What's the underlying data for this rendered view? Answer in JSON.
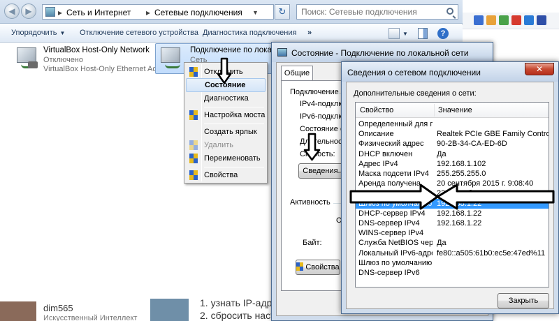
{
  "explorer": {
    "breadcrumb": [
      "Сеть и Интернет",
      "Сетевые подключения"
    ],
    "search_placeholder": "Поиск: Сетевые подключения",
    "toolbar": {
      "organize": "Упорядочить",
      "disable": "Отключение сетевого устройства",
      "diagnose": "Диагностика подключения"
    },
    "items": [
      {
        "name": "VirtualBox Host-Only Network",
        "status": "Отключено",
        "device": "VirtualBox Host-Only Ethernet Ad..."
      },
      {
        "name": "Подключение по локальн",
        "status": "Сеть"
      }
    ]
  },
  "context_menu": {
    "items": [
      {
        "label": "Отключить",
        "shield": true
      },
      {
        "label": "Состояние",
        "bold": true
      },
      {
        "label": "Диагностика"
      },
      {
        "label": "Настройка моста",
        "shield": true
      },
      {
        "label": "Создать ярлык"
      },
      {
        "label": "Удалить",
        "shield": true,
        "disabled": true
      },
      {
        "label": "Переименовать",
        "shield": true
      },
      {
        "label": "Свойства",
        "shield": true
      }
    ]
  },
  "status_dialog": {
    "title": "Состояние - Подключение по локальной сети",
    "tab": "Общие",
    "connection_group": "Подключение",
    "rows": [
      "IPv4-подключе",
      "IPv6-подключе",
      "Состояние сред",
      "Длительность:",
      "Скорость:"
    ],
    "details_button": "Сведения...",
    "activity_group": "Активность",
    "sent_label": "От",
    "bytes_label": "Байт:",
    "bytes_value": "1",
    "properties_button": "Свойства"
  },
  "details_dialog": {
    "title": "Сведения о сетевом подключении",
    "caption": "Дополнительные сведения о сети:",
    "col_property": "Свойство",
    "col_value": "Значение",
    "rows": [
      {
        "prop": "Определенный для по...",
        "value": ""
      },
      {
        "prop": "Описание",
        "value": "Realtek PCIe GBE Family Controller"
      },
      {
        "prop": "Физический адрес",
        "value": "90-2B-34-CA-ED-6D"
      },
      {
        "prop": "DHCP включен",
        "value": "Да"
      },
      {
        "prop": "Адрес IPv4",
        "value": "192.168.1.102"
      },
      {
        "prop": "Маска подсети IPv4",
        "value": "255.255.255.0"
      },
      {
        "prop": "Аренда получена",
        "value": "20 сентября 2015 г. 9:08:40"
      },
      {
        "prop": "Аренда истекает",
        "value": "23 сентября 2015 г. 22:33:04"
      },
      {
        "prop": "Шлюз по умолчанию IP...",
        "value": "192.168.1.22",
        "selected": true
      },
      {
        "prop": "DHCP-сервер IPv4",
        "value": "192.168.1.22"
      },
      {
        "prop": "DNS-сервер IPv4",
        "value": "192.168.1.22"
      },
      {
        "prop": "WINS-сервер IPv4",
        "value": ""
      },
      {
        "prop": "Служба NetBIOS через...",
        "value": "Да"
      },
      {
        "prop": "Локальный IPv6-адрес...",
        "value": "fe80::a505:61b0:ec5e:47ed%11"
      },
      {
        "prop": "Шлюз по умолчанию IP...",
        "value": ""
      },
      {
        "prop": "DNS-сервер IPv6",
        "value": ""
      }
    ],
    "close_button": "Закрыть"
  },
  "background": {
    "user_name": "dim565",
    "user_sub": "Искусственный Интеллект",
    "line1": "1. узнать IP-адрес, используемый по умолчанию.",
    "line2": "2. сбросить настройки роутера на заводские."
  },
  "colors": {
    "selection": "#3399ff",
    "arrow": "#000000"
  }
}
